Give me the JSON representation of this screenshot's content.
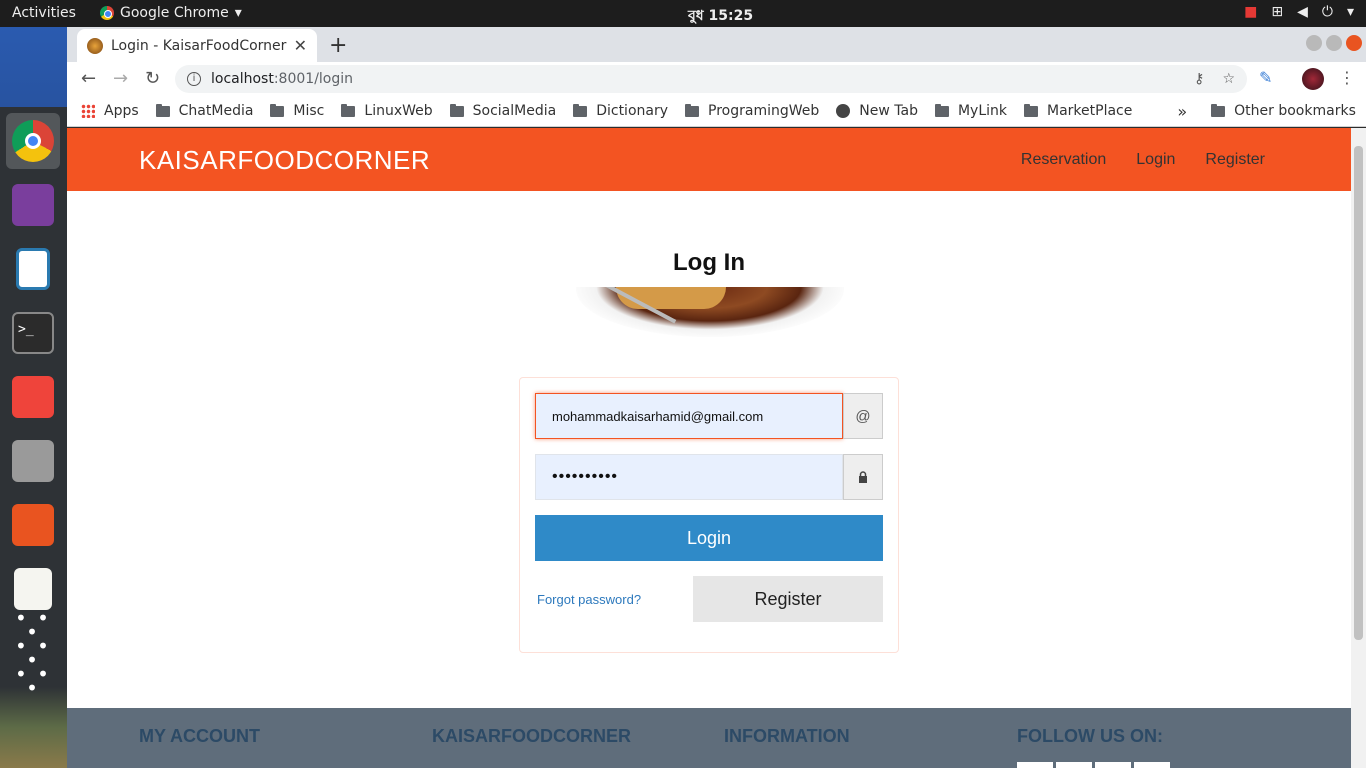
{
  "system": {
    "activities": "Activities",
    "app_name": "Google Chrome",
    "clock": "বুধ 15:25"
  },
  "browser": {
    "tab_title": "Login - KaisarFoodCorner",
    "url_host": "localhost",
    "url_path": ":8001/login",
    "bookmarks": [
      {
        "label": "Apps",
        "icon": "apps-icon"
      },
      {
        "label": "ChatMedia",
        "icon": "folder-icon"
      },
      {
        "label": "Misc",
        "icon": "folder-icon"
      },
      {
        "label": "LinuxWeb",
        "icon": "folder-icon"
      },
      {
        "label": "SocialMedia",
        "icon": "folder-icon"
      },
      {
        "label": "Dictionary",
        "icon": "folder-icon"
      },
      {
        "label": "ProgramingWeb",
        "icon": "folder-icon"
      },
      {
        "label": "New Tab",
        "icon": "globe-icon"
      },
      {
        "label": "MyLink",
        "icon": "folder-icon"
      },
      {
        "label": "MarketPlace",
        "icon": "folder-icon"
      }
    ],
    "bookmarks_more": "»",
    "other_bookmarks": "Other bookmarks"
  },
  "site": {
    "brand": "KAISARFOODCORNER",
    "nav": [
      "Reservation",
      "Login",
      "Register"
    ]
  },
  "login": {
    "title": "Log In",
    "email_value": "mohammadkaisarhamid@gmail.com",
    "email_addon": "@",
    "password_value": "••••••••••",
    "login_label": "Login",
    "forgot_label": "Forgot password?",
    "register_label": "Register"
  },
  "footer": {
    "columns": [
      "MY ACCOUNT",
      "KAISARFOODCORNER",
      "INFORMATION",
      "FOLLOW US ON:"
    ]
  },
  "colors": {
    "navbar": "#f35422",
    "login_button": "#2f8ac8",
    "footer": "#5f6d7b",
    "footer_heading": "#2c4a66"
  }
}
